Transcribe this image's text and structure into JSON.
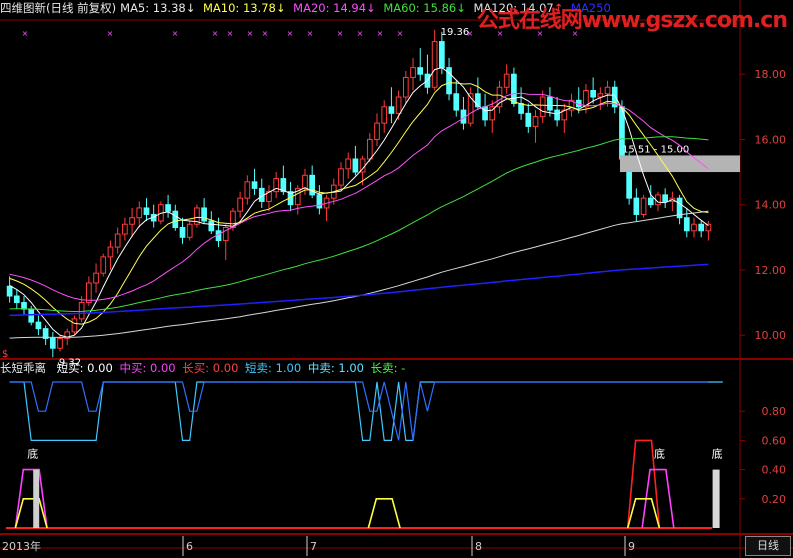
{
  "header": {
    "title": "四维图新(日线 前复权)",
    "ma5": "MA5: 13.38",
    "ma10": "MA10: 13.78",
    "ma20": "MA20: 14.94",
    "ma60": "MA60: 15.86",
    "ma120": "MA120: 14.07",
    "ma250": "MA250",
    "arrow_down": "↓",
    "arrow_up": "↑"
  },
  "watermark": "公式在线网www.gszx.com.cn",
  "colors": {
    "up": "#ff3b3b",
    "down": "#54ffff",
    "ma5": "#ffffff",
    "ma10": "#ffff50",
    "ma20": "#ff50ff",
    "ma60": "#40e040",
    "ma120": "#d8d8d8",
    "ma250": "#2020ff",
    "grid": "#8b0000"
  },
  "annotations": {
    "high": "19.36",
    "low": "9.32",
    "gap": "15.51 - 15.00",
    "sub_marker": "$"
  },
  "sub_header": {
    "name": "长短乖离",
    "short_buy": "短买: 0.00",
    "mid_buy": "中买: 0.00",
    "long_buy": "长买: 0.00",
    "short_sell": "短卖: 1.00",
    "mid_sell": "中卖: 1.00",
    "long_sell": "长卖: -"
  },
  "bottom_marks": [
    "底",
    "底",
    "底"
  ],
  "time_axis": [
    "2013年",
    "6",
    "7",
    "8",
    "9"
  ],
  "period_tab": "日线",
  "chart_data": [
    {
      "type": "candlestick",
      "title": "四维图新(日线 前复权)",
      "ylim": [
        9.3,
        19.6
      ],
      "y_ticks": [
        "10.00",
        "12.00",
        "14.00",
        "16.00",
        "18.00"
      ],
      "grid": false,
      "annotations": [
        "19.36",
        "9.32",
        "15.51 - 15.00"
      ],
      "series_names": [
        "MA5",
        "MA10",
        "MA20",
        "MA60",
        "MA120",
        "MA250"
      ],
      "x_labels": [
        "2013年",
        "6",
        "7",
        "8",
        "9"
      ],
      "ohlc": [
        [
          11.5,
          11.8,
          11.0,
          11.2
        ],
        [
          11.2,
          11.4,
          10.8,
          11.0
        ],
        [
          11.0,
          11.2,
          10.6,
          10.8
        ],
        [
          10.8,
          10.9,
          10.3,
          10.4
        ],
        [
          10.4,
          10.6,
          10.0,
          10.2
        ],
        [
          10.2,
          10.3,
          9.7,
          9.9
        ],
        [
          9.9,
          10.1,
          9.32,
          9.6
        ],
        [
          9.6,
          10.0,
          9.5,
          9.9
        ],
        [
          9.9,
          10.2,
          9.7,
          10.1
        ],
        [
          10.1,
          10.6,
          10.0,
          10.5
        ],
        [
          10.5,
          11.2,
          10.4,
          11.0
        ],
        [
          11.0,
          11.8,
          10.9,
          11.6
        ],
        [
          11.6,
          12.2,
          11.3,
          11.9
        ],
        [
          11.9,
          12.5,
          11.8,
          12.4
        ],
        [
          12.4,
          12.9,
          12.0,
          12.7
        ],
        [
          12.7,
          13.3,
          12.5,
          13.1
        ],
        [
          13.1,
          13.6,
          12.9,
          13.4
        ],
        [
          13.4,
          13.9,
          13.0,
          13.6
        ],
        [
          13.6,
          14.1,
          13.3,
          13.9
        ],
        [
          13.9,
          14.2,
          13.5,
          13.7
        ],
        [
          13.7,
          14.0,
          13.3,
          13.5
        ],
        [
          13.5,
          14.1,
          13.4,
          14.0
        ],
        [
          14.0,
          14.3,
          13.6,
          13.8
        ],
        [
          13.8,
          14.0,
          13.2,
          13.3
        ],
        [
          13.3,
          13.6,
          12.8,
          13.0
        ],
        [
          13.0,
          13.5,
          12.9,
          13.4
        ],
        [
          13.4,
          14.0,
          13.3,
          13.9
        ],
        [
          13.9,
          14.2,
          13.4,
          13.5
        ],
        [
          13.5,
          13.8,
          13.1,
          13.2
        ],
        [
          13.2,
          13.6,
          12.7,
          12.9
        ],
        [
          12.9,
          13.4,
          12.3,
          13.3
        ],
        [
          13.3,
          13.9,
          13.2,
          13.8
        ],
        [
          13.8,
          14.4,
          13.6,
          14.2
        ],
        [
          14.2,
          14.9,
          14.0,
          14.7
        ],
        [
          14.7,
          15.1,
          14.3,
          14.5
        ],
        [
          14.5,
          14.8,
          13.9,
          14.1
        ],
        [
          14.1,
          14.6,
          13.8,
          14.4
        ],
        [
          14.4,
          15.0,
          14.2,
          14.8
        ],
        [
          14.8,
          15.2,
          14.3,
          14.4
        ],
        [
          14.4,
          14.7,
          13.8,
          14.0
        ],
        [
          14.0,
          14.6,
          13.7,
          14.5
        ],
        [
          14.5,
          15.1,
          14.3,
          14.9
        ],
        [
          14.9,
          15.2,
          14.2,
          14.3
        ],
        [
          14.3,
          14.6,
          13.7,
          13.9
        ],
        [
          13.9,
          14.3,
          13.5,
          14.2
        ],
        [
          14.2,
          14.8,
          14.0,
          14.6
        ],
        [
          14.6,
          15.3,
          14.5,
          15.1
        ],
        [
          15.1,
          15.6,
          14.8,
          15.4
        ],
        [
          15.4,
          15.8,
          14.9,
          15.0
        ],
        [
          15.0,
          15.5,
          14.6,
          15.4
        ],
        [
          15.4,
          16.2,
          15.3,
          16.0
        ],
        [
          16.0,
          16.8,
          15.8,
          16.5
        ],
        [
          16.5,
          17.2,
          16.2,
          17.0
        ],
        [
          17.0,
          17.6,
          16.5,
          16.8
        ],
        [
          16.8,
          17.5,
          16.6,
          17.3
        ],
        [
          17.3,
          18.1,
          17.1,
          17.9
        ],
        [
          17.9,
          18.5,
          17.5,
          18.2
        ],
        [
          18.2,
          18.8,
          17.8,
          18.0
        ],
        [
          18.0,
          18.6,
          17.4,
          17.6
        ],
        [
          17.6,
          19.36,
          17.5,
          19.0
        ],
        [
          19.0,
          19.3,
          18.0,
          18.2
        ],
        [
          18.2,
          18.5,
          17.2,
          17.4
        ],
        [
          17.4,
          17.8,
          16.7,
          16.9
        ],
        [
          16.9,
          17.3,
          16.3,
          16.5
        ],
        [
          16.5,
          17.6,
          16.4,
          17.4
        ],
        [
          17.4,
          17.9,
          16.9,
          17.0
        ],
        [
          17.0,
          17.4,
          16.4,
          16.6
        ],
        [
          16.6,
          17.2,
          16.2,
          17.0
        ],
        [
          17.0,
          17.8,
          16.8,
          17.6
        ],
        [
          17.6,
          18.3,
          17.4,
          18.0
        ],
        [
          18.0,
          18.2,
          17.0,
          17.1
        ],
        [
          17.1,
          17.6,
          16.6,
          16.8
        ],
        [
          16.8,
          17.1,
          16.2,
          16.4
        ],
        [
          16.4,
          16.9,
          15.9,
          16.7
        ],
        [
          16.7,
          17.5,
          16.5,
          17.3
        ],
        [
          17.3,
          17.6,
          16.7,
          16.9
        ],
        [
          16.9,
          17.3,
          16.4,
          16.6
        ],
        [
          16.6,
          17.1,
          16.2,
          16.9
        ],
        [
          16.9,
          17.4,
          16.7,
          17.2
        ],
        [
          17.2,
          17.6,
          16.8,
          17.0
        ],
        [
          17.0,
          17.7,
          16.8,
          17.5
        ],
        [
          17.5,
          17.9,
          17.1,
          17.3
        ],
        [
          17.3,
          17.6,
          16.9,
          17.4
        ],
        [
          17.4,
          17.8,
          17.0,
          17.6
        ],
        [
          17.6,
          17.8,
          16.8,
          17.0
        ],
        [
          17.0,
          17.2,
          15.0,
          15.4
        ],
        [
          15.4,
          15.6,
          14.0,
          14.2
        ],
        [
          14.2,
          14.5,
          13.5,
          13.7
        ],
        [
          13.7,
          14.3,
          13.6,
          14.2
        ],
        [
          14.2,
          14.6,
          13.9,
          14.0
        ],
        [
          14.0,
          14.4,
          13.8,
          14.3
        ],
        [
          14.3,
          14.5,
          13.9,
          14.1
        ],
        [
          14.1,
          14.4,
          13.8,
          14.2
        ],
        [
          14.2,
          14.3,
          13.4,
          13.6
        ],
        [
          13.6,
          13.9,
          13.0,
          13.2
        ],
        [
          13.2,
          13.6,
          13.0,
          13.4
        ],
        [
          13.4,
          13.5,
          13.0,
          13.2
        ],
        [
          13.2,
          13.5,
          12.9,
          13.4
        ]
      ]
    },
    {
      "type": "line",
      "title": "长短乖离",
      "ylim": [
        0,
        1.0
      ],
      "y_ticks": [
        "0.20",
        "0.40",
        "0.60",
        "0.80"
      ],
      "series_names": [
        "短买",
        "中买",
        "长买",
        "短卖",
        "中卖",
        "长卖"
      ],
      "sell_signal": [
        1,
        1,
        1,
        1,
        0.8,
        0.8,
        1,
        1,
        1,
        1,
        1,
        0.8,
        0.8,
        1,
        1,
        1,
        1,
        1,
        1,
        1,
        1,
        1,
        1,
        1,
        1,
        0.8,
        0.8,
        1,
        1,
        1,
        1,
        1,
        1,
        1,
        1,
        1,
        1,
        1,
        1,
        1,
        1,
        1,
        1,
        1,
        1,
        1,
        1,
        1,
        1,
        1,
        0.8,
        0.8,
        1,
        0.8,
        0.6,
        1,
        0.6,
        1,
        0.8,
        1,
        1,
        1,
        1,
        1,
        1,
        1,
        1,
        1,
        1,
        1,
        1,
        1,
        1,
        1,
        1,
        1,
        1,
        1,
        1,
        1,
        1,
        1,
        1,
        1,
        1,
        1,
        1,
        1,
        1,
        1,
        1,
        1,
        1,
        1,
        1,
        1,
        1,
        1
      ],
      "sell_signal_2": [
        1,
        1,
        1,
        0.6,
        0.6,
        0.6,
        0.6,
        0.6,
        0.6,
        0.6,
        0.6,
        0.6,
        0.6,
        1,
        1,
        1,
        1,
        1,
        1,
        1,
        1,
        1,
        1,
        1,
        0.6,
        0.6,
        1,
        1,
        1,
        1,
        1,
        1,
        1,
        1,
        1,
        1,
        1,
        1,
        1,
        1,
        1,
        1,
        1,
        1,
        1,
        1,
        1,
        1,
        1,
        0.6,
        0.6,
        1,
        0.6,
        0.6,
        1,
        0.6,
        0.6,
        1,
        1,
        1,
        1,
        1,
        1,
        1,
        1,
        1,
        1,
        1,
        1,
        1,
        1,
        1,
        1,
        1,
        1,
        1,
        1,
        1,
        1,
        1,
        1,
        1,
        1,
        1,
        1,
        1,
        1,
        1,
        1,
        1,
        1,
        1,
        1,
        1,
        1,
        1,
        1,
        1,
        1,
        1
      ],
      "buy_pulses": [
        {
          "index": 3,
          "height": 0.4,
          "color": "magenta",
          "label": "底"
        },
        {
          "index": 3,
          "height": 0.2,
          "color": "yellow"
        },
        {
          "index": 52,
          "height": 0.2,
          "color": "yellow"
        },
        {
          "index": 88,
          "height": 0.6,
          "color": "red"
        },
        {
          "index": 90,
          "height": 0.4,
          "color": "magenta",
          "label": "底"
        },
        {
          "index": 88,
          "height": 0.2,
          "color": "yellow"
        },
        {
          "index": 98,
          "height": 0.4,
          "color": "white",
          "label": "底"
        }
      ]
    }
  ]
}
